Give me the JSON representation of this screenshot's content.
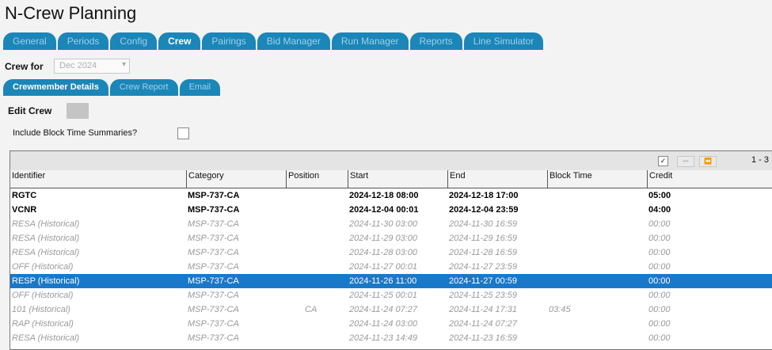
{
  "app": {
    "title": "N-Crew Planning"
  },
  "main_tabs": [
    {
      "label": "General",
      "active": false
    },
    {
      "label": "Periods",
      "active": false
    },
    {
      "label": "Config",
      "active": false
    },
    {
      "label": "Crew",
      "active": true
    },
    {
      "label": "Pairings",
      "active": false
    },
    {
      "label": "Bid Manager",
      "active": false
    },
    {
      "label": "Run Manager",
      "active": false
    },
    {
      "label": "Reports",
      "active": false
    },
    {
      "label": "Line Simulator",
      "active": false
    }
  ],
  "crew_for": {
    "label": "Crew for",
    "value": "Dec 2024"
  },
  "sub_tabs": [
    {
      "label": "Crewmember Details",
      "active": true
    },
    {
      "label": "Crew Report",
      "active": false
    },
    {
      "label": "Email",
      "active": false
    }
  ],
  "edit_crew": {
    "label": "Edit Crew"
  },
  "include_block": {
    "label": "Include Block Time Summaries?",
    "checked": false
  },
  "grid": {
    "pager": {
      "info": "1 - 3",
      "check": "✓",
      "first": "⏮",
      "prev": "⏪"
    },
    "columns": [
      "Identifier",
      "Category",
      "Position",
      "Start",
      "End",
      "Block Time",
      "Credit"
    ],
    "rows": [
      {
        "identifier": "RGTC",
        "category": "MSP-737-CA",
        "position": "",
        "start": "2024-12-18 08:00",
        "end": "2024-12-18 17:00",
        "block": "",
        "credit": "05:00",
        "state": "current"
      },
      {
        "identifier": "VCNR",
        "category": "MSP-737-CA",
        "position": "",
        "start": "2024-12-04 00:01",
        "end": "2024-12-04 23:59",
        "block": "",
        "credit": "04:00",
        "state": "current"
      },
      {
        "identifier": "RESA (Historical)",
        "category": "MSP-737-CA",
        "position": "",
        "start": "2024-11-30 03:00",
        "end": "2024-11-30 16:59",
        "block": "",
        "credit": "00:00",
        "state": "hist"
      },
      {
        "identifier": "RESA (Historical)",
        "category": "MSP-737-CA",
        "position": "",
        "start": "2024-11-29 03:00",
        "end": "2024-11-29 16:59",
        "block": "",
        "credit": "00:00",
        "state": "hist"
      },
      {
        "identifier": "RESA (Historical)",
        "category": "MSP-737-CA",
        "position": "",
        "start": "2024-11-28 03:00",
        "end": "2024-11-28 16:59",
        "block": "",
        "credit": "00:00",
        "state": "hist"
      },
      {
        "identifier": "OFF (Historical)",
        "category": "MSP-737-CA",
        "position": "",
        "start": "2024-11-27 00:01",
        "end": "2024-11-27 23:59",
        "block": "",
        "credit": "00:00",
        "state": "hist"
      },
      {
        "identifier": "RESP (Historical)",
        "category": "MSP-737-CA",
        "position": "",
        "start": "2024-11-26 11:00",
        "end": "2024-11-27 00:59",
        "block": "",
        "credit": "00:00",
        "state": "selected"
      },
      {
        "identifier": "OFF (Historical)",
        "category": "MSP-737-CA",
        "position": "",
        "start": "2024-11-25 00:01",
        "end": "2024-11-25 23:59",
        "block": "",
        "credit": "00:00",
        "state": "hist"
      },
      {
        "identifier": "101 (Historical)",
        "category": "MSP-737-CA",
        "position": "CA",
        "start": "2024-11-24 07:27",
        "end": "2024-11-24 17:31",
        "block": "03:45",
        "credit": "00:00",
        "state": "hist"
      },
      {
        "identifier": "RAP (Historical)",
        "category": "MSP-737-CA",
        "position": "",
        "start": "2024-11-24 03:00",
        "end": "2024-11-24 07:27",
        "block": "",
        "credit": "00:00",
        "state": "hist"
      },
      {
        "identifier": "RESA (Historical)",
        "category": "MSP-737-CA",
        "position": "",
        "start": "2024-11-23 14:49",
        "end": "2024-11-23 16:59",
        "block": "",
        "credit": "00:00",
        "state": "hist"
      }
    ]
  },
  "colors": {
    "tab_bg": "#1b86b8",
    "selected_row": "#1a78c8",
    "historical_text": "#9a9a9a"
  }
}
